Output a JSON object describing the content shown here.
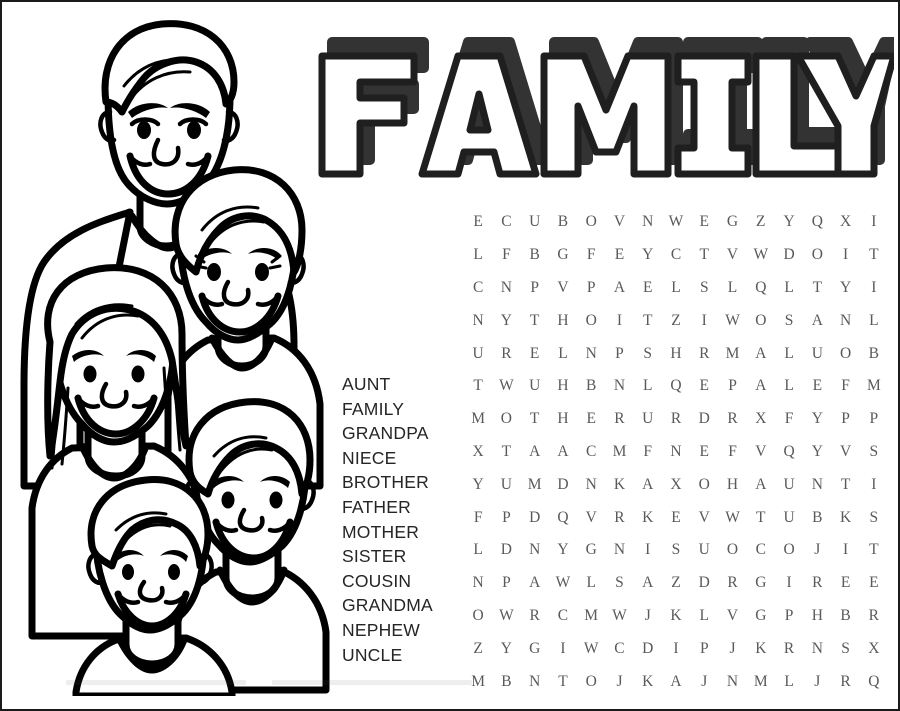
{
  "page": {
    "title": "FAMILY",
    "kind": "word-search-coloring-page",
    "background_color": "#ffffff",
    "border_color": "#1a1a1a",
    "ink_color": "#000000",
    "letter_color": "#5a5a5a",
    "wordlist_color": "#252525",
    "title_face_color": "#ffffff",
    "title_outline_color": "#1f1f1f",
    "title_shadow_color": "#333333"
  },
  "illustration": {
    "name": "family-line-art",
    "description": "Black and white coloring-book line drawing of a family group",
    "members": [
      "father",
      "mother",
      "daughter",
      "son",
      "little-brother"
    ]
  },
  "wordlist": {
    "name": "word-bank",
    "words": [
      "AUNT",
      "FAMILY",
      "GRANDPA",
      "NIECE",
      "BROTHER",
      "FATHER",
      "MOTHER",
      "SISTER",
      "COUSIN",
      "GRANDMA",
      "NEPHEW",
      "UNCLE"
    ]
  },
  "grid": {
    "name": "letter-grid",
    "rows": 14,
    "columns": 15,
    "letters": [
      [
        "E",
        "C",
        "U",
        "B",
        "O",
        "V",
        "N",
        "W",
        "E",
        "G",
        "Z",
        "Y",
        "Q",
        "X",
        "I"
      ],
      [
        "L",
        "F",
        "B",
        "G",
        "F",
        "E",
        "Y",
        "C",
        "T",
        "V",
        "W",
        "D",
        "O",
        "I",
        "T"
      ],
      [
        "C",
        "N",
        "P",
        "V",
        "P",
        "A",
        "E",
        "L",
        "S",
        "L",
        "Q",
        "L",
        "T",
        "Y",
        "I"
      ],
      [
        "N",
        "Y",
        "T",
        "H",
        "O",
        "I",
        "T",
        "Z",
        "I",
        "W",
        "O",
        "S",
        "A",
        "N",
        "L"
      ],
      [
        "U",
        "R",
        "E",
        "L",
        "N",
        "P",
        "S",
        "H",
        "R",
        "M",
        "A",
        "L",
        "U",
        "O",
        "B"
      ],
      [
        "T",
        "W",
        "U",
        "H",
        "B",
        "N",
        "L",
        "Q",
        "E",
        "P",
        "A",
        "L",
        "E",
        "F",
        "M"
      ],
      [
        "M",
        "O",
        "T",
        "H",
        "E",
        "R",
        "U",
        "R",
        "D",
        "R",
        "X",
        "F",
        "Y",
        "P",
        "P"
      ],
      [
        "X",
        "T",
        "A",
        "A",
        "C",
        "M",
        "F",
        "N",
        "E",
        "F",
        "V",
        "Q",
        "Y",
        "V",
        "S"
      ],
      [
        "Y",
        "U",
        "M",
        "D",
        "N",
        "K",
        "A",
        "X",
        "O",
        "H",
        "A",
        "U",
        "N",
        "T",
        "I"
      ],
      [
        "F",
        "P",
        "D",
        "Q",
        "V",
        "R",
        "K",
        "E",
        "V",
        "W",
        "T",
        "U",
        "B",
        "K",
        "S"
      ],
      [
        "L",
        "D",
        "N",
        "Y",
        "G",
        "N",
        "I",
        "S",
        "U",
        "O",
        "C",
        "O",
        "J",
        "I",
        "T"
      ],
      [
        "N",
        "P",
        "A",
        "W",
        "L",
        "S",
        "A",
        "Z",
        "D",
        "R",
        "G",
        "I",
        "R",
        "E",
        "E"
      ],
      [
        "O",
        "W",
        "R",
        "C",
        "M",
        "W",
        "J",
        "K",
        "L",
        "V",
        "G",
        "P",
        "H",
        "B",
        "R"
      ],
      [
        "Z",
        "Y",
        "G",
        "I",
        "W",
        "C",
        "D",
        "I",
        "P",
        "J",
        "K",
        "R",
        "N",
        "S",
        "X"
      ],
      [
        "M",
        "B",
        "N",
        "T",
        "O",
        "J",
        "K",
        "A",
        "J",
        "N",
        "M",
        "L",
        "J",
        "R",
        "Q"
      ]
    ]
  }
}
